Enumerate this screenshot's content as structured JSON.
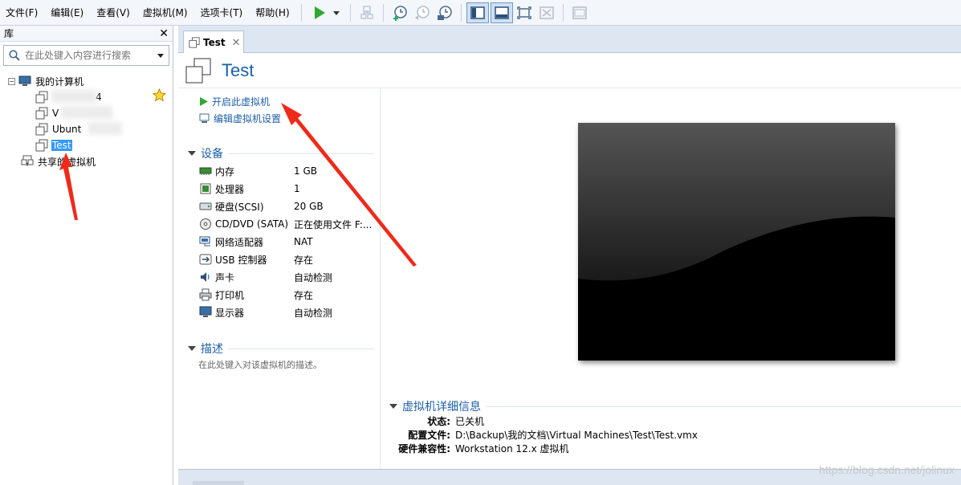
{
  "menu": [
    "文件(F)",
    "编辑(E)",
    "查看(V)",
    "虚拟机(M)",
    "选项卡(T)",
    "帮助(H)"
  ],
  "library": {
    "title": "库",
    "search_placeholder": "在此处键入内容进行搜索",
    "tree": {
      "root": "我的计算机",
      "vm1_partial": "4",
      "vm2_partial": "V",
      "vm3_partial": "Ubunt",
      "vm4": "Test",
      "shared": "共享的虚拟机"
    }
  },
  "tab": {
    "label": "Test"
  },
  "vm": {
    "title": "Test",
    "actions": {
      "power_on": "开启此虚拟机",
      "edit_settings": "编辑虚拟机设置"
    },
    "devices_heading": "设备",
    "devices": [
      {
        "name": "内存",
        "value": "1 GB",
        "icon": "memory-icon"
      },
      {
        "name": "处理器",
        "value": "1",
        "icon": "cpu-icon"
      },
      {
        "name": "硬盘(SCSI)",
        "value": "20 GB",
        "icon": "harddisk-icon"
      },
      {
        "name": "CD/DVD (SATA)",
        "value": "正在使用文件 F:...",
        "icon": "cd-icon"
      },
      {
        "name": "网络适配器",
        "value": "NAT",
        "icon": "network-icon"
      },
      {
        "name": "USB 控制器",
        "value": "存在",
        "icon": "usb-icon"
      },
      {
        "name": "声卡",
        "value": "自动检测",
        "icon": "sound-icon"
      },
      {
        "name": "打印机",
        "value": "存在",
        "icon": "printer-icon"
      },
      {
        "name": "显示器",
        "value": "自动检测",
        "icon": "display-icon"
      }
    ],
    "description_heading": "描述",
    "description_placeholder": "在此处键入对该虚拟机的描述。",
    "details_heading": "虚拟机详细信息",
    "details": {
      "state_label": "状态:",
      "state_value": "已关机",
      "config_label": "配置文件:",
      "config_value": "D:\\Backup\\我的文档\\Virtual Machines\\Test\\Test.vmx",
      "compat_label": "硬件兼容性:",
      "compat_value": "Workstation 12.x 虚拟机"
    }
  },
  "watermark": "https://blog.csdn.net/jolinux",
  "colors": {
    "accent": "#1f5fa8",
    "selection": "#3399ff",
    "annotation_arrow": "#ee2a1a",
    "play": "#2fa82f"
  }
}
